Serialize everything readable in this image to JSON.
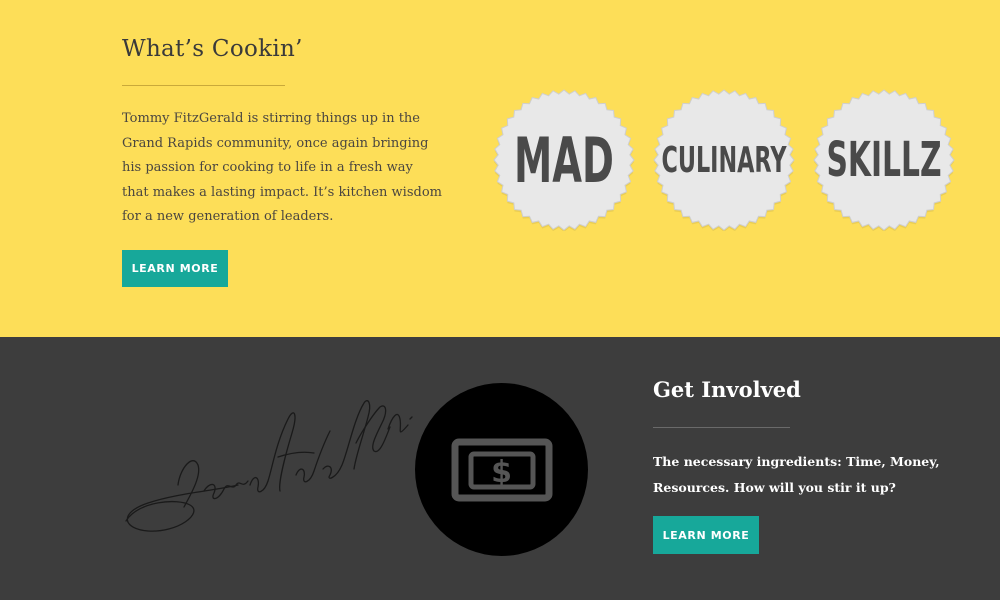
{
  "cooking_section": {
    "heading": "What’s Cookin’",
    "paragraph": "Tommy FitzGerald is stirring things up in the Grand Rapids community, once again bringing his passion for cooking to life in a fresh way that makes a lasting impact. It’s kitchen wisdom for a new generation of leaders.",
    "button_label": "LEARN MORE",
    "badges": [
      "MAD",
      "CULINARY",
      "SKILLZ"
    ]
  },
  "involved_section": {
    "heading": "Get Involved",
    "paragraph": "The necessary ingredients: Time, Money, Resources. How will you stir it up?",
    "button_label": "LEARN MORE"
  },
  "colors": {
    "top_background": "#fdde58",
    "bottom_background": "#3d3d3d",
    "accent_button": "#17a89a",
    "badge_fill": "#e8e8e8"
  },
  "icons": [
    "signature-image",
    "money-icon"
  ]
}
